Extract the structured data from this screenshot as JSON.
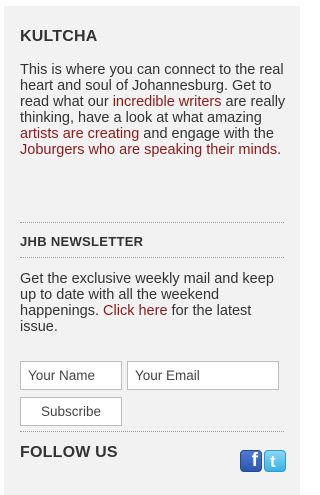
{
  "kultcha": {
    "title": "KULTCHA",
    "p1": "This is where you can connect to the real heart and soul of Johannesburg. Get to read what our ",
    "link1": "incredible writers",
    "p2": " are really thinking, have a look at what amazing ",
    "link2": "artists are creating",
    "p3": " and engage with the ",
    "link3": "Joburgers who are speaking their minds",
    "p4": "."
  },
  "newsletter": {
    "title": "JHB NEWSLETTER",
    "text1": "Get the exclusive weekly mail and keep up to date with all the weekend happenings. ",
    "link": "Click here",
    "text2": " for the latest issue.",
    "name_placeholder": "Your Name",
    "email_placeholder": "Your Email",
    "subscribe_label": "Subscribe"
  },
  "follow": {
    "title": "FOLLOW US",
    "facebook_icon": "facebook-icon",
    "twitter_icon": "twitter-icon"
  },
  "colors": {
    "link": "#8b1a1a",
    "panel": "#f2f2f2",
    "facebook": "#3b5998",
    "twitter": "#55acee"
  }
}
